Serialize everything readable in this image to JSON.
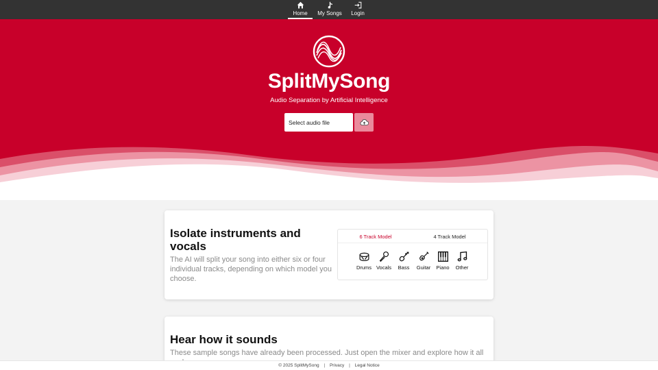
{
  "nav": {
    "items": [
      {
        "label": "Home",
        "icon": "home-icon",
        "active": true
      },
      {
        "label": "My Songs",
        "icon": "music-note-icon"
      },
      {
        "label": "Login",
        "icon": "login-icon"
      }
    ]
  },
  "hero": {
    "title": "SplitMySong",
    "subtitle": "Audio Separation by Artificial Intelligence",
    "file_placeholder": "Select audio file",
    "upload_icon": "cloud-upload-icon",
    "background_color": "#c8002a",
    "logo_icon": "sound-wave-logo-icon"
  },
  "feature": {
    "heading": "Isolate instruments and vocals",
    "description": "The AI will split your song into either six or four individual tracks, depending on which model you choose.",
    "tabs": [
      {
        "label": "6 Track Model",
        "active": true
      },
      {
        "label": "4 Track Model",
        "active": false
      }
    ],
    "instruments": [
      {
        "label": "Drums",
        "icon": "drum-icon"
      },
      {
        "label": "Vocals",
        "icon": "microphone-icon"
      },
      {
        "label": "Bass",
        "icon": "bass-icon"
      },
      {
        "label": "Guitar",
        "icon": "guitar-icon"
      },
      {
        "label": "Piano",
        "icon": "piano-icon"
      },
      {
        "label": "Other",
        "icon": "music-icon"
      }
    ]
  },
  "samples": {
    "heading": "Hear how it sounds",
    "description": "These sample songs have already been processed. Just open the mixer and explore how it all works."
  },
  "footer": {
    "copyright": "© 2025 SplitMySong",
    "separator": "|",
    "links": [
      "Privacy",
      "Legal Notice"
    ]
  },
  "colors": {
    "accent": "#c8002a",
    "nav_bg": "#333333",
    "upload_button": "#ea8a9c"
  }
}
